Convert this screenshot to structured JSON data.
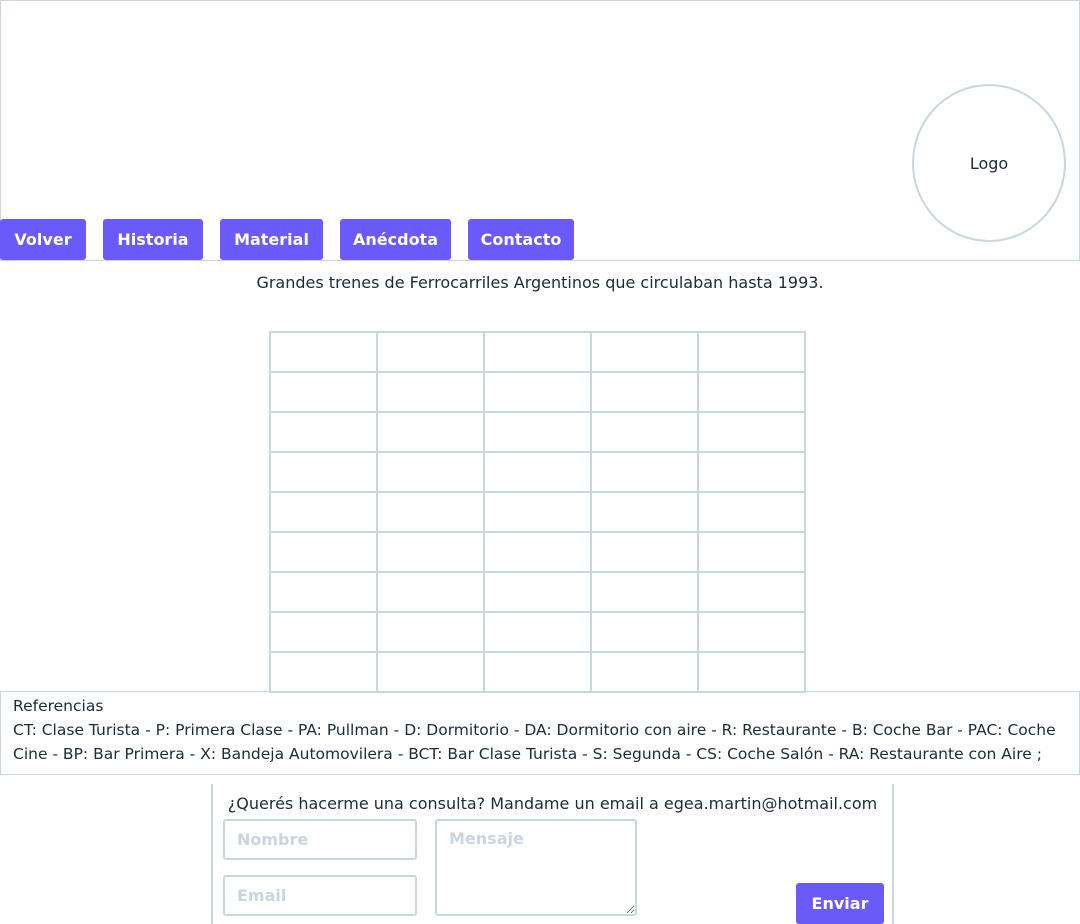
{
  "header": {
    "logo_label": "Logo",
    "nav": {
      "back": "Volver",
      "history": "Historia",
      "material": "Material",
      "anecdote": "Anécdota",
      "contact": "Contacto"
    }
  },
  "main": {
    "subtitle": "Grandes trenes de Ferrocarriles Argentinos que circulaban hasta 1993."
  },
  "references": {
    "title": "Referencias",
    "text": "CT: Clase Turista - P: Primera Clase - PA: Pullman - D: Dormitorio - DA: Dormitorio con aire - R: Restaurante - B: Coche Bar - PAC: Coche Cine - BP: Bar Primera - X: Bandeja Automovilera - BCT: Bar Clase Turista - S: Segunda - CS: Coche Salón - RA: Restaurante con Aire ;"
  },
  "contact": {
    "message": "¿Querés hacerme una consulta? Mandame un email a egea.martin@hotmail.com",
    "name_placeholder": "Nombre",
    "email_placeholder": "Email",
    "message_placeholder": "Mensaje",
    "name_value": "",
    "email_value": "",
    "send_label": "Enviar"
  },
  "colors": {
    "accent": "#6a5af9",
    "border": "#cbd5e1",
    "text": "#1f2937"
  }
}
